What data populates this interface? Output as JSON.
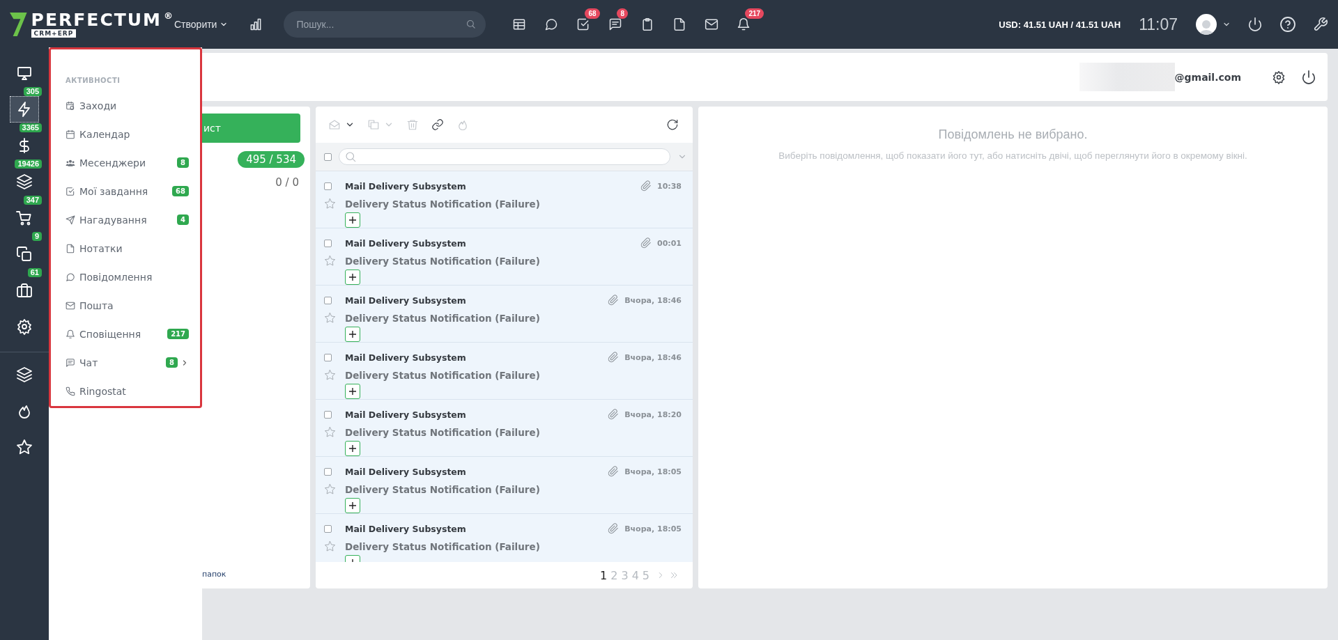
{
  "topbar": {
    "logo": {
      "name": "PERFECTUM",
      "mark": "®",
      "tag": "CRM+ERP"
    },
    "create_menu": "Створити",
    "search": {
      "placeholder": "Пошук..."
    },
    "quick_actions": [
      {
        "kind": "table"
      },
      {
        "kind": "chat"
      },
      {
        "kind": "task",
        "badge": "68"
      },
      {
        "kind": "messages",
        "badge": "8"
      },
      {
        "kind": "clipboard"
      },
      {
        "kind": "note"
      },
      {
        "kind": "mail"
      },
      {
        "kind": "bell",
        "badge": "217"
      }
    ],
    "currency": "USD: 41.51 UAH / 41.51 UAH",
    "clock": "11:07"
  },
  "sidebar": {
    "items": [
      {
        "kind": "monitor",
        "selected": false
      },
      {
        "kind": "bolt",
        "badge": "305",
        "selected": true
      },
      {
        "kind": "dollar",
        "badge": "3365",
        "selected": false
      },
      {
        "kind": "layers",
        "badge": "19426",
        "selected": false
      },
      {
        "kind": "cart",
        "badge": "347",
        "selected": false
      },
      {
        "kind": "copy",
        "badge": "9",
        "selected": false
      },
      {
        "kind": "briefcase",
        "badge": "61",
        "selected": false
      },
      {
        "kind": "gear",
        "selected": false
      },
      {
        "kind": "layers",
        "selected": false
      },
      {
        "kind": "fire",
        "selected": false
      },
      {
        "kind": "star",
        "selected": false
      }
    ]
  },
  "activity_menu": {
    "heading": "АКТИВНОСТІ",
    "items": [
      {
        "kind": "events",
        "label": "Заходи",
        "submenu": false
      },
      {
        "kind": "calendar",
        "label": "Календар",
        "submenu": false
      },
      {
        "kind": "users",
        "label": "Месенджери",
        "badge": "8",
        "submenu": false
      },
      {
        "kind": "task",
        "label": "Мої завдання",
        "badge": "68",
        "submenu": false
      },
      {
        "kind": "send",
        "label": "Нагадування",
        "badge": "4",
        "submenu": false
      },
      {
        "kind": "note",
        "label": "Нотатки",
        "submenu": false
      },
      {
        "kind": "chat",
        "label": "Повідомлення",
        "submenu": false
      },
      {
        "kind": "mail",
        "label": "Пошта",
        "submenu": false
      },
      {
        "kind": "bell",
        "label": "Сповіщення",
        "badge": "217",
        "submenu": false
      },
      {
        "kind": "messages",
        "label": "Чат",
        "badge": "8",
        "submenu": true
      },
      {
        "kind": "phone",
        "label": "Ringostat",
        "submenu": false
      }
    ]
  },
  "mail_header": {
    "account": "@gmail.com"
  },
  "folders": {
    "compose_button": "ист",
    "counters": [
      {
        "text": "495 / 534",
        "highlighted": true
      },
      {
        "text": "0 / 0",
        "highlighted": false
      }
    ],
    "settings_link": "папок"
  },
  "mail_list": {
    "toolbar": [
      {
        "kind": "read",
        "disabled": true
      },
      {
        "kind": "caret",
        "disabled": false
      },
      {
        "kind": "move",
        "disabled": true
      },
      {
        "kind": "caret",
        "disabled": true
      },
      {
        "kind": "trash",
        "disabled": true
      },
      {
        "kind": "link",
        "disabled": false
      },
      {
        "kind": "fire",
        "disabled": true
      },
      {
        "kind": "refresh",
        "disabled": false
      }
    ],
    "select_all": {
      "checked": false
    },
    "messages": [
      {
        "sender": "Mail Delivery Subsystem",
        "subject": "Delivery Status Notification (Failure)",
        "time": "10:38",
        "attachment": true,
        "checked": false,
        "starred": false
      },
      {
        "sender": "Mail Delivery Subsystem",
        "subject": "Delivery Status Notification (Failure)",
        "time": "00:01",
        "attachment": true,
        "checked": false,
        "starred": false
      },
      {
        "sender": "Mail Delivery Subsystem",
        "subject": "Delivery Status Notification (Failure)",
        "time": "Вчора, 18:46",
        "attachment": true,
        "checked": false,
        "starred": false
      },
      {
        "sender": "Mail Delivery Subsystem",
        "subject": "Delivery Status Notification (Failure)",
        "time": "Вчора, 18:46",
        "attachment": true,
        "checked": false,
        "starred": false
      },
      {
        "sender": "Mail Delivery Subsystem",
        "subject": "Delivery Status Notification (Failure)",
        "time": "Вчора, 18:20",
        "attachment": true,
        "checked": false,
        "starred": false
      },
      {
        "sender": "Mail Delivery Subsystem",
        "subject": "Delivery Status Notification (Failure)",
        "time": "Вчора, 18:05",
        "attachment": true,
        "checked": false,
        "starred": false
      },
      {
        "sender": "Mail Delivery Subsystem",
        "subject": "Delivery Status Notification (Failure)",
        "time": "Вчора, 18:05",
        "attachment": true,
        "checked": false,
        "starred": false
      }
    ],
    "pagination": {
      "pages": [
        {
          "label": "1",
          "selected": true
        },
        {
          "label": "2",
          "selected": false
        },
        {
          "label": "3",
          "selected": false
        },
        {
          "label": "4",
          "selected": false
        },
        {
          "label": "5",
          "selected": false
        }
      ]
    }
  },
  "preview": {
    "title": "Повідомлень не вибрано.",
    "hint": "Виберіть повідомлення, щоб показати його тут, або натисніть двічі, щоб переглянути його в окремому вікні."
  }
}
